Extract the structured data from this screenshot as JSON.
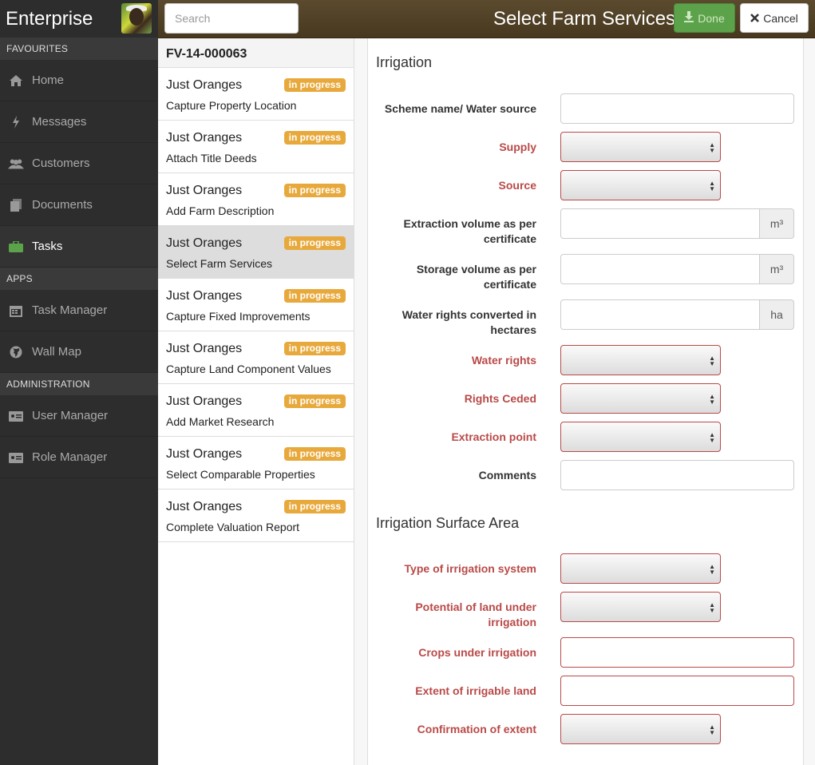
{
  "app": {
    "title": "Enterprise"
  },
  "sidebar": {
    "sections": [
      {
        "label": "FAVOURITES",
        "items": [
          {
            "label": "Home",
            "icon": "home-icon"
          },
          {
            "label": "Messages",
            "icon": "bolt-icon"
          },
          {
            "label": "Customers",
            "icon": "users-icon"
          },
          {
            "label": "Documents",
            "icon": "documents-icon"
          },
          {
            "label": "Tasks",
            "icon": "briefcase-icon",
            "active": true
          }
        ]
      },
      {
        "label": "APPS",
        "items": [
          {
            "label": "Task Manager",
            "icon": "calendar-icon"
          },
          {
            "label": "Wall Map",
            "icon": "globe-icon"
          }
        ]
      },
      {
        "label": "ADMINISTRATION",
        "items": [
          {
            "label": "User Manager",
            "icon": "id-card-icon"
          },
          {
            "label": "Role Manager",
            "icon": "id-card-icon"
          }
        ]
      }
    ]
  },
  "topbar": {
    "search_placeholder": "Search",
    "page_title": "Select Farm Services",
    "done_label": "Done",
    "cancel_label": "Cancel"
  },
  "tasks": {
    "header": "FV-14-000063",
    "items": [
      {
        "name": "Just Oranges",
        "status": "in progress",
        "task": "Capture Property Location"
      },
      {
        "name": "Just Oranges",
        "status": "in progress",
        "task": "Attach Title Deeds"
      },
      {
        "name": "Just Oranges",
        "status": "in progress",
        "task": "Add Farm Description"
      },
      {
        "name": "Just Oranges",
        "status": "in progress",
        "task": "Select Farm Services",
        "selected": true
      },
      {
        "name": "Just Oranges",
        "status": "in progress",
        "task": "Capture Fixed Improvements"
      },
      {
        "name": "Just Oranges",
        "status": "in progress",
        "task": "Capture Land Component Values"
      },
      {
        "name": "Just Oranges",
        "status": "in progress",
        "task": "Add Market Research"
      },
      {
        "name": "Just Oranges",
        "status": "in progress",
        "task": "Select Comparable Properties"
      },
      {
        "name": "Just Oranges",
        "status": "in progress",
        "task": "Complete Valuation Report"
      }
    ]
  },
  "form": {
    "irrigation": {
      "legend": "Irrigation",
      "scheme_name": "Scheme name/ Water source",
      "supply": "Supply",
      "source": "Source",
      "extraction_volume": "Extraction volume as per certificate",
      "storage_volume": "Storage volume as per certificate",
      "water_rights_hectares": "Water rights converted in hectares",
      "water_rights": "Water rights",
      "rights_ceded": "Rights Ceded",
      "extraction_point": "Extraction point",
      "comments": "Comments",
      "unit_m3": "m³",
      "unit_ha": "ha"
    },
    "surface": {
      "legend": "Irrigation Surface Area",
      "type_of_system": "Type of irrigation system",
      "potential_land": "Potential of land under irrigation",
      "crops": "Crops under irrigation",
      "extent_irrigable": "Extent of irrigable land",
      "confirmation_extent": "Confirmation of extent"
    }
  },
  "colors": {
    "topbar": "#4f4026",
    "sidebar": "#2d2d2d",
    "badge": "#e8a93c",
    "required": "#b94a48",
    "done_button": "#5ca24a"
  }
}
